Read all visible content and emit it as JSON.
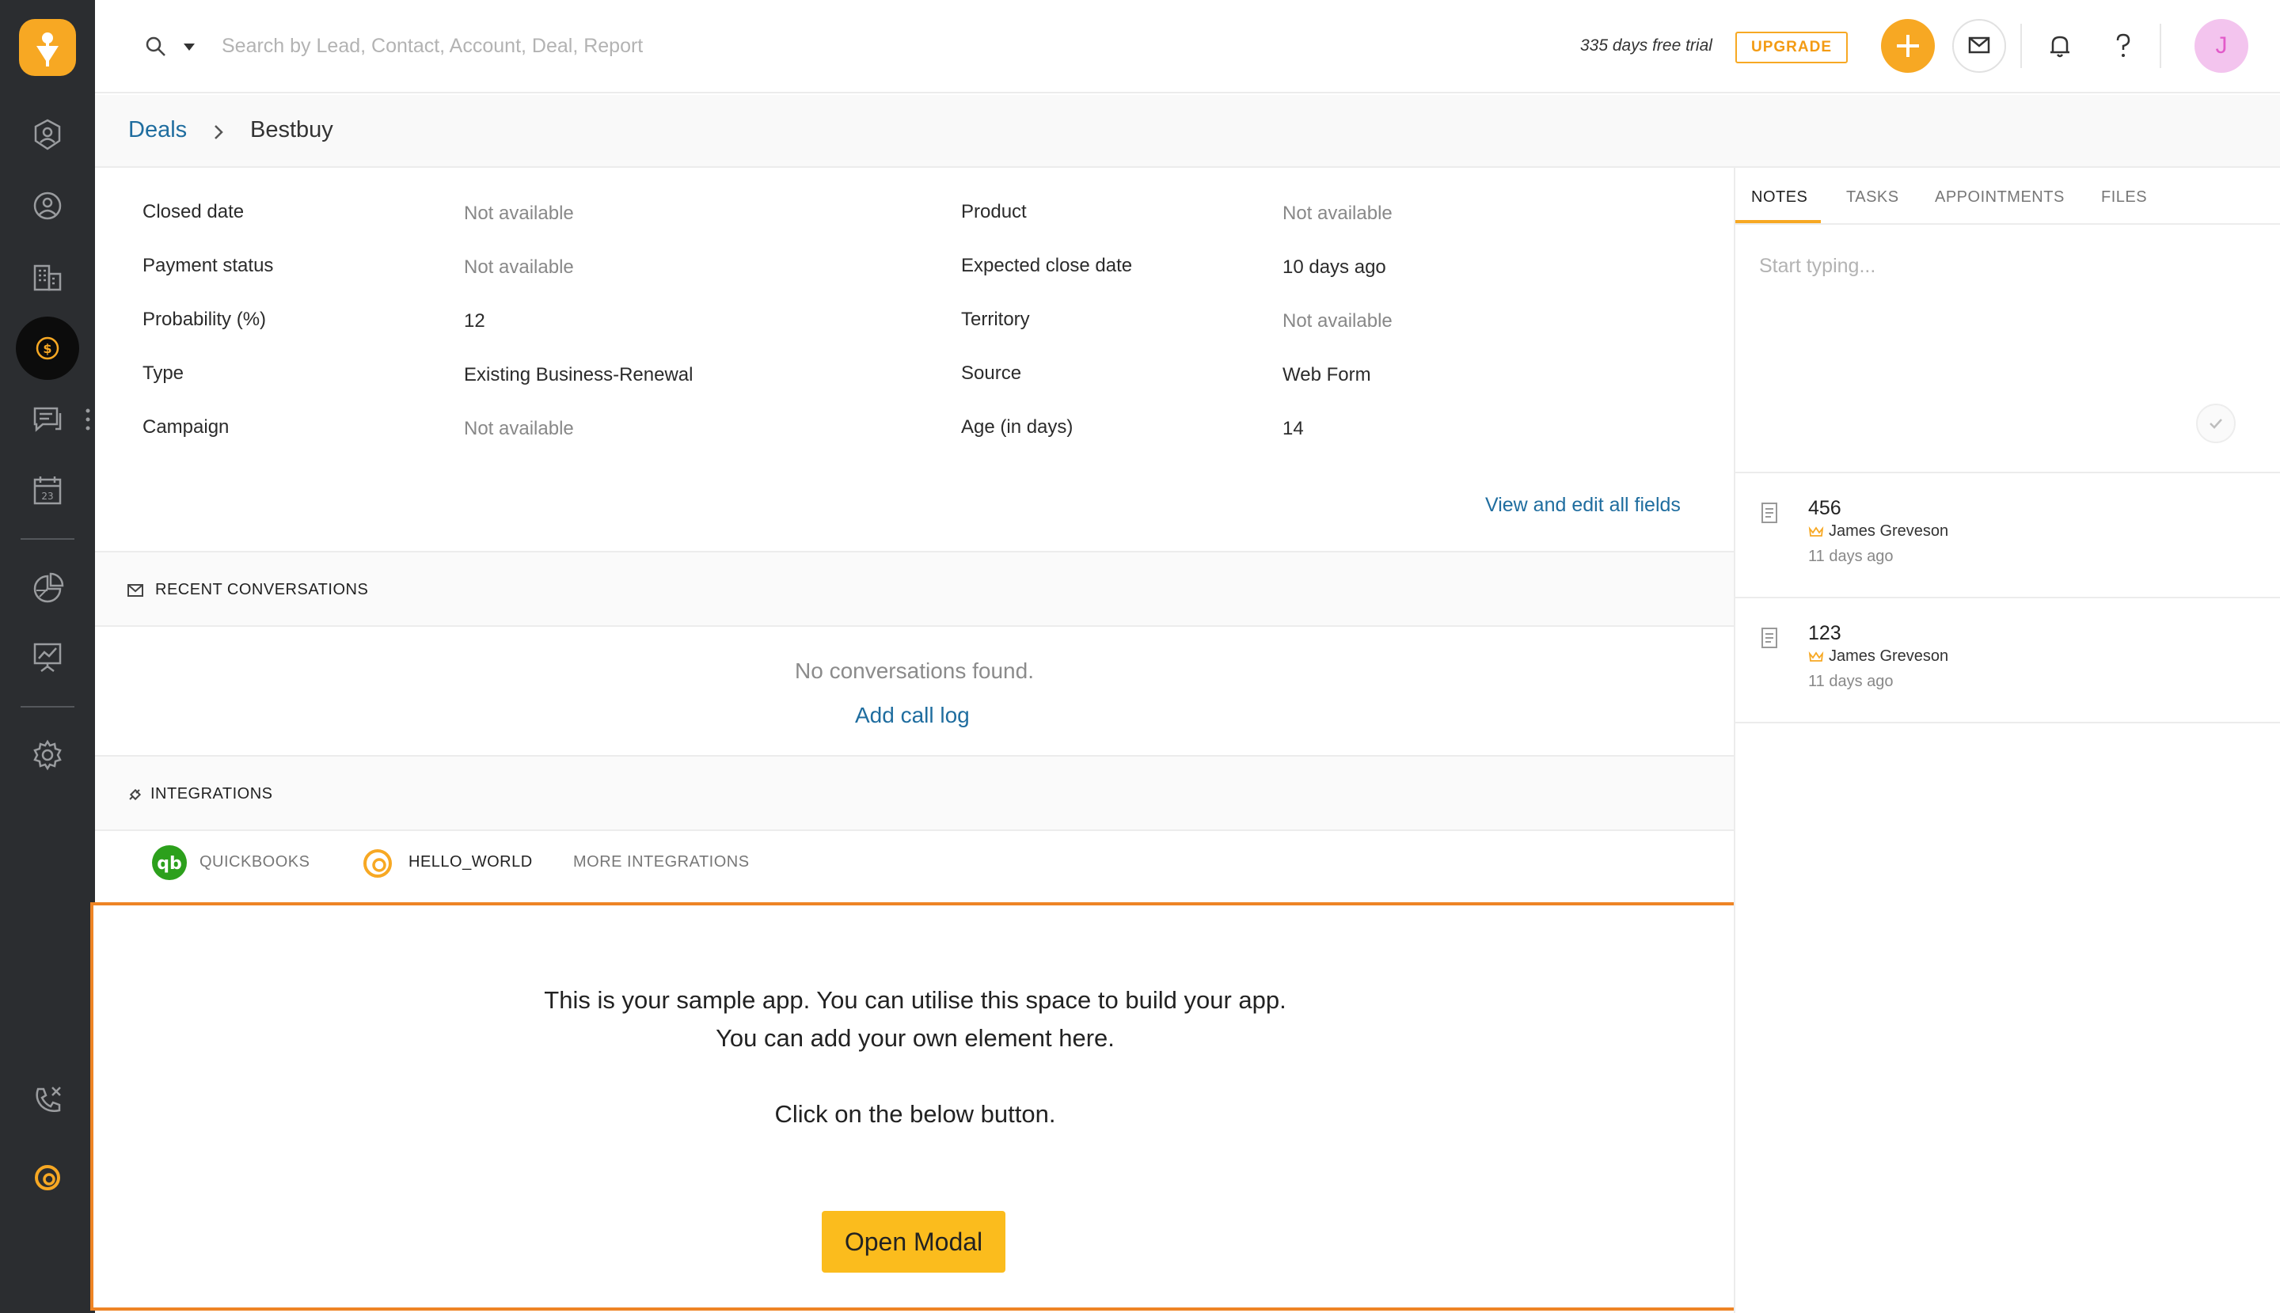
{
  "header": {
    "search_placeholder": "Search by Lead, Contact, Account, Deal, Report",
    "trial_text": "335 days free trial",
    "upgrade_label": "UPGRADE",
    "avatar_initial": "J"
  },
  "breadcrumb": {
    "parent": "Deals",
    "current": "Bestbuy"
  },
  "fields": {
    "left": [
      {
        "label": "Closed date",
        "value": "Not available"
      },
      {
        "label": "Payment status",
        "value": "Not available"
      },
      {
        "label": "Probability (%)",
        "value": "12"
      },
      {
        "label": "Type",
        "value": "Existing Business-Renewal"
      },
      {
        "label": "Campaign",
        "value": "Not available"
      }
    ],
    "right": [
      {
        "label": "Product",
        "value": "Not available"
      },
      {
        "label": "Expected close date",
        "value": "10 days ago"
      },
      {
        "label": "Territory",
        "value": "Not available"
      },
      {
        "label": "Source",
        "value": "Web Form"
      },
      {
        "label": "Age (in days)",
        "value": "14"
      }
    ],
    "edit_link": "View and edit all fields"
  },
  "conversations": {
    "title": "RECENT CONVERSATIONS",
    "empty_text": "No conversations found.",
    "add_link": "Add call log"
  },
  "integrations": {
    "title": "INTEGRATIONS",
    "tabs": [
      "QUICKBOOKS",
      "HELLO_WORLD",
      "MORE INTEGRATIONS"
    ]
  },
  "sample_app": {
    "line1": "This is your sample app. You can utilise this space to build your app.",
    "line2": "You can add your own element here.",
    "line3": "Click on the below button.",
    "button_label": "Open Modal"
  },
  "right_panel": {
    "tabs": [
      "NOTES",
      "TASKS",
      "APPOINTMENTS",
      "FILES"
    ],
    "note_placeholder": "Start typing...",
    "notes": [
      {
        "title": "456",
        "author": "James Greveson",
        "time": "11 days ago"
      },
      {
        "title": "123",
        "author": "James Greveson",
        "time": "11 days ago"
      }
    ]
  },
  "colors": {
    "accent": "#f7a823",
    "link": "#1f6d9f",
    "sidebar": "#2b2d30",
    "highlight_border": "#ee8425",
    "modal_button": "#fbbc1d"
  }
}
